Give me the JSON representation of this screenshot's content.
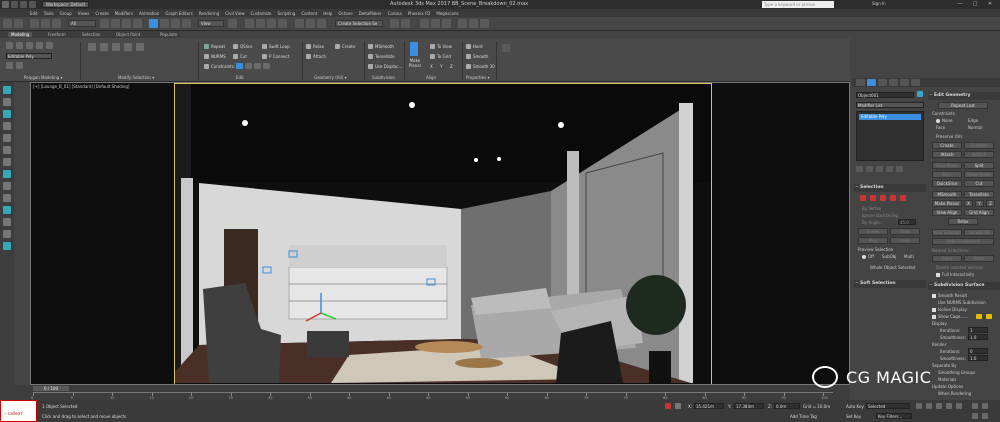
{
  "titlebar": {
    "workspace": "Workspace: Default",
    "title": "Autodesk 3ds Max 2017   BB_Scene_Breakdown_02.max",
    "search_placeholder": "Type a keyword or phrase",
    "signin": "Sign In",
    "min": "—",
    "max": "□",
    "close": "✕"
  },
  "menubar": [
    "Edit",
    "Tools",
    "Group",
    "Views",
    "Create",
    "Modifiers",
    "Animation",
    "Graph Editors",
    "Rendering",
    "Civil View",
    "Customize",
    "Scripting",
    "Content",
    "Help",
    "Octane",
    "DeltaMaker",
    "Corona",
    "Phoenix FD",
    "Megascans"
  ],
  "toolbar": {
    "filter": "All",
    "coord": "View",
    "selection_set": "Create Selection Se"
  },
  "ribbon": {
    "tabs": [
      "Modeling",
      "Freeform",
      "Selection",
      "Object Paint",
      "Populate"
    ],
    "active_tab": "Modeling",
    "poly_label": "Editable Poly",
    "groups": {
      "polygon_modeling": "Polygon Modeling ▾",
      "modify_selection": "Modify Selection ▾",
      "edit": "Edit",
      "geometry": "Geometry (All) ▾",
      "subdivision": "Subdivision",
      "align": "Align",
      "properties": "Properties ▾"
    },
    "edit_buttons": [
      "Repeat",
      "QSlice",
      "Swift Loop",
      "NURMS",
      "Cut",
      "P Connect",
      "Constraints:"
    ],
    "geometry_buttons": [
      "Relax",
      "Create",
      "Attach"
    ],
    "subdivision_buttons": [
      "MSmooth",
      "Tessellate",
      "Use Displac..."
    ],
    "align_buttons": [
      "Make Planar",
      "To View",
      "To Grid",
      "X",
      "Y",
      "Z"
    ],
    "properties_buttons": [
      "Hard",
      "Smooth",
      "Smooth 30"
    ]
  },
  "viewport": {
    "label": "[+] [Lounge_B_01] [Standard] [Default Shading]"
  },
  "command_panel": {
    "object_name": "Object001",
    "modifier_list": "Modifier List",
    "stack_item": "Editable Poly",
    "selection_rollout": "Selection",
    "soft_selection_rollout": "Soft Selection",
    "selection_items": [
      "By Vertex",
      "Ignore Backfacing",
      "By Angle:",
      "Shrink",
      "Grow",
      "Ring",
      "Loop"
    ],
    "angle_value": "45.0",
    "preview_label": "Preview Selection",
    "preview_options": [
      "Off",
      "SubObj",
      "Multi"
    ],
    "whole_selected": "Whole Object Selected",
    "edit_geometry_rollout": "Edit Geometry",
    "repeat_last": "Repeat Last",
    "constraints_label": "Constraints",
    "constraints": [
      "None",
      "Edge",
      "Face",
      "Normal"
    ],
    "preserve_uvs": "Preserve UVs",
    "geom_buttons": [
      "Create",
      "Collapse",
      "Attach",
      "Detach",
      "Slice Plane",
      "Split",
      "Slice",
      "Reset Plane",
      "QuickSlice",
      "Cut",
      "MSmooth",
      "Tessellate",
      "Make Planar",
      "X",
      "Y",
      "Z",
      "View Align",
      "Grid Align",
      "Relax",
      "Hide Selected",
      "Unhide All",
      "Hide Unselected",
      "Copy",
      "Paste"
    ],
    "named_selections": "Named Selections:",
    "delete_isolated": "Delete Isolated Vertices",
    "full_interactivity": "Full Interactivity",
    "subdivision_rollout": "Subdivision Surface",
    "smooth_result": "Smooth Result",
    "use_nurms": "Use NURMS Subdivision",
    "isoline": "Isoline Display",
    "show_cage": "Show Cage......",
    "display_label": "Display",
    "iterations_label": "Iterations:",
    "smoothness_label": "Smoothness:",
    "iterations_display": "1",
    "smoothness_display": "1.0",
    "render_label": "Render",
    "iterations_render": "0",
    "smoothness_render": "1.0",
    "separate_by": "Separate By",
    "smoothing_groups": "Smoothing Groups",
    "materials": "Materials",
    "update_options": "Update Options",
    "when_rendering": "When Rendering"
  },
  "timeline": {
    "frame": "0 / 100",
    "ticks": [
      "0",
      "5",
      "10",
      "15",
      "20",
      "25",
      "30",
      "35",
      "40",
      "45",
      "50",
      "55",
      "60",
      "65",
      "70",
      "75",
      "80",
      "85",
      "90",
      "95",
      "100"
    ]
  },
  "statusbar": {
    "script_text": "-- called f",
    "selected": "1 Object Selected",
    "prompt": "Click and drag to select and move objects",
    "x_label": "X:",
    "x_value": "35.421m",
    "y_label": "Y:",
    "y_value": "17.384m",
    "z_label": "Z:",
    "z_value": "0.0m",
    "grid": "Grid = 10.0m",
    "add_time_tag": "Add Time Tag",
    "auto_key": "Auto Key",
    "set_key": "Set Key",
    "selected_dd": "Selected",
    "key_filters": "Key Filters..."
  },
  "watermark": {
    "text": "CG MAGIC"
  },
  "colors": {
    "accent_blue": "#3a8fe0",
    "frame_yellow": "#d8c25a",
    "script_red": "#cc0000"
  }
}
